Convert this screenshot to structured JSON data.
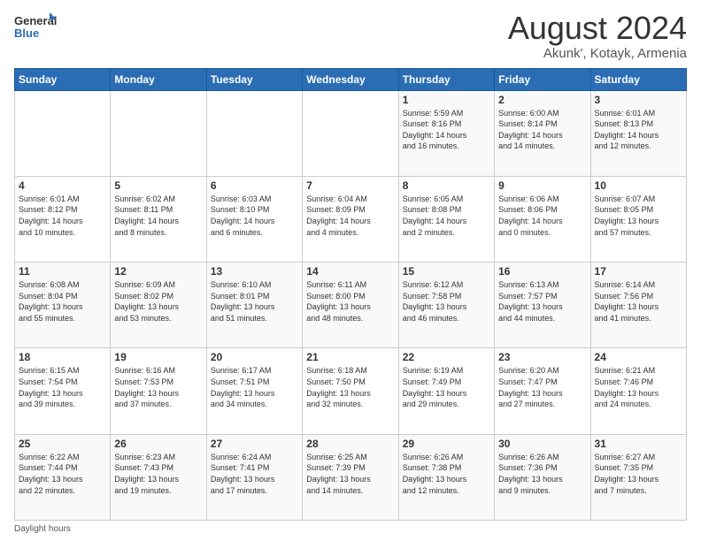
{
  "logo": {
    "line1": "General",
    "line2": "Blue"
  },
  "title": "August 2024",
  "subtitle": "Akunk', Kotayk, Armenia",
  "days_of_week": [
    "Sunday",
    "Monday",
    "Tuesday",
    "Wednesday",
    "Thursday",
    "Friday",
    "Saturday"
  ],
  "footer_text": "Daylight hours",
  "weeks": [
    [
      {
        "day": "",
        "info": ""
      },
      {
        "day": "",
        "info": ""
      },
      {
        "day": "",
        "info": ""
      },
      {
        "day": "",
        "info": ""
      },
      {
        "day": "1",
        "info": "Sunrise: 5:59 AM\nSunset: 8:16 PM\nDaylight: 14 hours\nand 16 minutes."
      },
      {
        "day": "2",
        "info": "Sunrise: 6:00 AM\nSunset: 8:14 PM\nDaylight: 14 hours\nand 14 minutes."
      },
      {
        "day": "3",
        "info": "Sunrise: 6:01 AM\nSunset: 8:13 PM\nDaylight: 14 hours\nand 12 minutes."
      }
    ],
    [
      {
        "day": "4",
        "info": "Sunrise: 6:01 AM\nSunset: 8:12 PM\nDaylight: 14 hours\nand 10 minutes."
      },
      {
        "day": "5",
        "info": "Sunrise: 6:02 AM\nSunset: 8:11 PM\nDaylight: 14 hours\nand 8 minutes."
      },
      {
        "day": "6",
        "info": "Sunrise: 6:03 AM\nSunset: 8:10 PM\nDaylight: 14 hours\nand 6 minutes."
      },
      {
        "day": "7",
        "info": "Sunrise: 6:04 AM\nSunset: 8:09 PM\nDaylight: 14 hours\nand 4 minutes."
      },
      {
        "day": "8",
        "info": "Sunrise: 6:05 AM\nSunset: 8:08 PM\nDaylight: 14 hours\nand 2 minutes."
      },
      {
        "day": "9",
        "info": "Sunrise: 6:06 AM\nSunset: 8:06 PM\nDaylight: 14 hours\nand 0 minutes."
      },
      {
        "day": "10",
        "info": "Sunrise: 6:07 AM\nSunset: 8:05 PM\nDaylight: 13 hours\nand 57 minutes."
      }
    ],
    [
      {
        "day": "11",
        "info": "Sunrise: 6:08 AM\nSunset: 8:04 PM\nDaylight: 13 hours\nand 55 minutes."
      },
      {
        "day": "12",
        "info": "Sunrise: 6:09 AM\nSunset: 8:02 PM\nDaylight: 13 hours\nand 53 minutes."
      },
      {
        "day": "13",
        "info": "Sunrise: 6:10 AM\nSunset: 8:01 PM\nDaylight: 13 hours\nand 51 minutes."
      },
      {
        "day": "14",
        "info": "Sunrise: 6:11 AM\nSunset: 8:00 PM\nDaylight: 13 hours\nand 48 minutes."
      },
      {
        "day": "15",
        "info": "Sunrise: 6:12 AM\nSunset: 7:58 PM\nDaylight: 13 hours\nand 46 minutes."
      },
      {
        "day": "16",
        "info": "Sunrise: 6:13 AM\nSunset: 7:57 PM\nDaylight: 13 hours\nand 44 minutes."
      },
      {
        "day": "17",
        "info": "Sunrise: 6:14 AM\nSunset: 7:56 PM\nDaylight: 13 hours\nand 41 minutes."
      }
    ],
    [
      {
        "day": "18",
        "info": "Sunrise: 6:15 AM\nSunset: 7:54 PM\nDaylight: 13 hours\nand 39 minutes."
      },
      {
        "day": "19",
        "info": "Sunrise: 6:16 AM\nSunset: 7:53 PM\nDaylight: 13 hours\nand 37 minutes."
      },
      {
        "day": "20",
        "info": "Sunrise: 6:17 AM\nSunset: 7:51 PM\nDaylight: 13 hours\nand 34 minutes."
      },
      {
        "day": "21",
        "info": "Sunrise: 6:18 AM\nSunset: 7:50 PM\nDaylight: 13 hours\nand 32 minutes."
      },
      {
        "day": "22",
        "info": "Sunrise: 6:19 AM\nSunset: 7:49 PM\nDaylight: 13 hours\nand 29 minutes."
      },
      {
        "day": "23",
        "info": "Sunrise: 6:20 AM\nSunset: 7:47 PM\nDaylight: 13 hours\nand 27 minutes."
      },
      {
        "day": "24",
        "info": "Sunrise: 6:21 AM\nSunset: 7:46 PM\nDaylight: 13 hours\nand 24 minutes."
      }
    ],
    [
      {
        "day": "25",
        "info": "Sunrise: 6:22 AM\nSunset: 7:44 PM\nDaylight: 13 hours\nand 22 minutes."
      },
      {
        "day": "26",
        "info": "Sunrise: 6:23 AM\nSunset: 7:43 PM\nDaylight: 13 hours\nand 19 minutes."
      },
      {
        "day": "27",
        "info": "Sunrise: 6:24 AM\nSunset: 7:41 PM\nDaylight: 13 hours\nand 17 minutes."
      },
      {
        "day": "28",
        "info": "Sunrise: 6:25 AM\nSunset: 7:39 PM\nDaylight: 13 hours\nand 14 minutes."
      },
      {
        "day": "29",
        "info": "Sunrise: 6:26 AM\nSunset: 7:38 PM\nDaylight: 13 hours\nand 12 minutes."
      },
      {
        "day": "30",
        "info": "Sunrise: 6:26 AM\nSunset: 7:36 PM\nDaylight: 13 hours\nand 9 minutes."
      },
      {
        "day": "31",
        "info": "Sunrise: 6:27 AM\nSunset: 7:35 PM\nDaylight: 13 hours\nand 7 minutes."
      }
    ]
  ]
}
